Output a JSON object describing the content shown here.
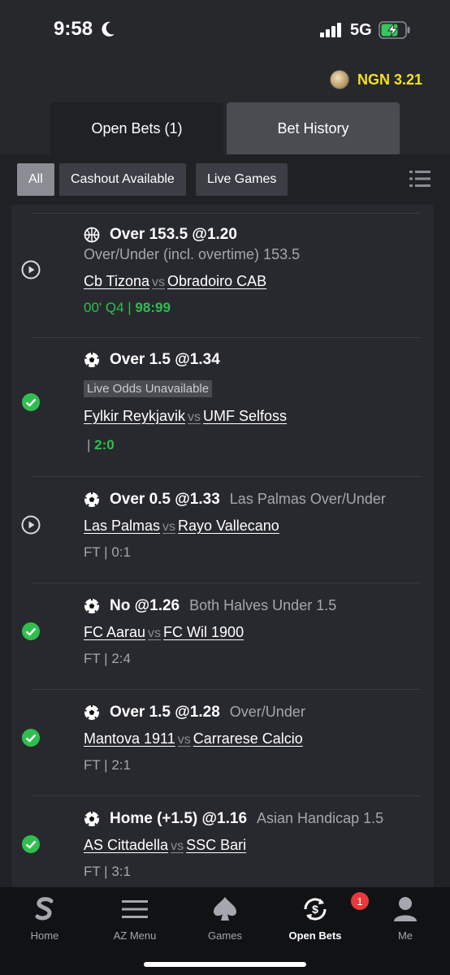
{
  "status_bar": {
    "time": "9:58",
    "network": "5G"
  },
  "header": {
    "balance": "NGN 3.21"
  },
  "tabs": [
    {
      "label": "Open Bets (1)"
    },
    {
      "label": "Bet History"
    }
  ],
  "filters": [
    {
      "label": "All"
    },
    {
      "label": "Cashout Available"
    },
    {
      "label": "Live Games"
    }
  ],
  "bets": [
    {
      "sport": "basketball-icon",
      "status": "live-play-icon",
      "pick": "Over 153.5 @1.20",
      "market": "Over/Under (incl. overtime) 153.5",
      "home": "Cb Tizona",
      "vs": "vs",
      "away": "Obradoiro CAB",
      "score_prefix": "00' Q4 | ",
      "score": "98:99"
    },
    {
      "sport": "football-icon",
      "status": "won-check-icon",
      "pick": "Over 1.5 @1.34",
      "unavailable": "Live Odds Unavailable",
      "home": "Fylkir Reykjavik",
      "vs": "vs",
      "away": "UMF Selfoss",
      "score_prefix": "| ",
      "score": "2:0"
    },
    {
      "sport": "football-icon",
      "status": "live-play-icon",
      "pick": "Over 0.5 @1.33",
      "market": "Las Palmas Over/Under",
      "home": "Las Palmas",
      "vs": "vs",
      "away": "Rayo Vallecano",
      "result": "FT | 0:1"
    },
    {
      "sport": "football-icon",
      "status": "won-check-icon",
      "pick": "No @1.26",
      "market": "Both Halves Under 1.5",
      "home": "FC Aarau",
      "vs": "vs",
      "away": "FC Wil 1900",
      "result": "FT | 2:4"
    },
    {
      "sport": "football-icon",
      "status": "won-check-icon",
      "pick": "Over 1.5 @1.28",
      "market": "Over/Under",
      "home": "Mantova 1911",
      "vs": "vs",
      "away": "Carrarese Calcio",
      "result": "FT | 2:1"
    },
    {
      "sport": "football-icon",
      "status": "won-check-icon",
      "pick": "Home (+1.5) @1.16",
      "market": "Asian Handicap 1.5",
      "home": "AS Cittadella",
      "vs": "vs",
      "away": "SSC Bari",
      "result": "FT | 3:1"
    }
  ],
  "nav": [
    {
      "label": "Home",
      "icon": "sportybet-logo-icon"
    },
    {
      "label": "AZ Menu",
      "icon": "hamburger-menu-icon"
    },
    {
      "label": "Games",
      "icon": "spade-icon"
    },
    {
      "label": "Open Bets",
      "icon": "open-bets-icon",
      "badge": "1"
    },
    {
      "label": "Me",
      "icon": "user-icon"
    }
  ],
  "colors": {
    "accent_green": "#2fbf4f",
    "balance_yellow": "#f5e11a",
    "badge_red": "#e8383b"
  }
}
